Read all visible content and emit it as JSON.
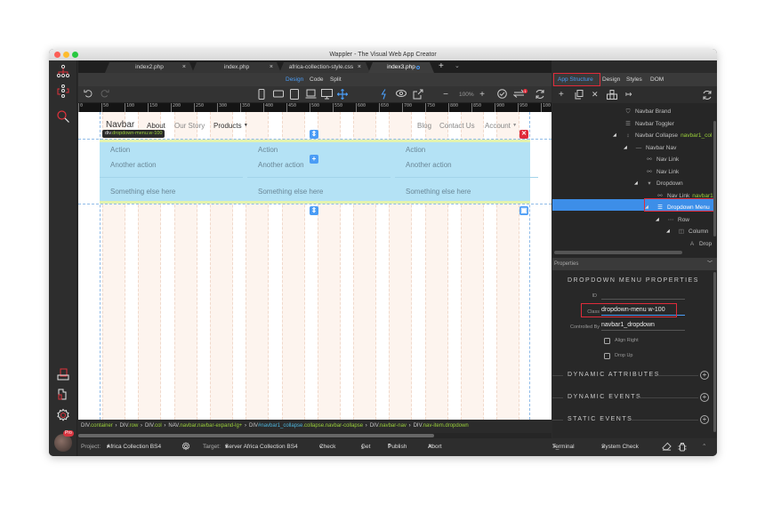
{
  "window": {
    "title": "Wappler - The Visual Web App Creator"
  },
  "tabs": [
    {
      "label": "index2.php",
      "closable": true,
      "active": false
    },
    {
      "label": "index.php",
      "closable": true,
      "active": false
    },
    {
      "label": "africa-collection-style.css",
      "closable": true,
      "active": false
    },
    {
      "label": "index3.php",
      "closable": false,
      "active": true,
      "modified": true
    }
  ],
  "tab_add": "+",
  "tab_more": "⌄",
  "modes": {
    "design": "Design",
    "code": "Code",
    "split": "Split",
    "active": "Design"
  },
  "toolbar": {
    "zoom_level": "100%",
    "zoom_out": "−",
    "zoom_in": "+",
    "notification_count": "1"
  },
  "ruler": {
    "ticks": [
      "0",
      "50",
      "100",
      "150",
      "200",
      "250",
      "300",
      "350",
      "400",
      "450",
      "500",
      "550",
      "600",
      "650",
      "700",
      "750",
      "800",
      "850",
      "900",
      "950",
      "100"
    ]
  },
  "page": {
    "navbar": {
      "brand": "Navbar",
      "links_left": [
        "About",
        "Our Story",
        "Products"
      ],
      "links_right": [
        "Blog",
        "Contact Us",
        "Account"
      ]
    },
    "element_tooltip": {
      "tag": "div",
      "classes": ".dropdown-menu.w-100"
    },
    "dropdown_columns": [
      {
        "items": [
          "Action",
          "Another action",
          "Something else here"
        ]
      },
      {
        "items": [
          "Action",
          "Another action",
          "Something else here"
        ]
      },
      {
        "items": [
          "Action",
          "Another action",
          "Something else here"
        ]
      }
    ]
  },
  "breadcrumb": [
    {
      "tag": "DIV",
      "cls": ".container",
      "id": ""
    },
    {
      "tag": "DIV",
      "cls": ".row",
      "id": ""
    },
    {
      "tag": "DIV",
      "cls": ".col",
      "id": ""
    },
    {
      "tag": "NAV",
      "cls": ".navbar.navbar-expand-lg+",
      "id": ""
    },
    {
      "tag": "DIV",
      "cls": ".collapse.navbar-collapse",
      "id": "#navbar1_collapse"
    },
    {
      "tag": "DIV",
      "cls": ".navbar-nav",
      "id": ""
    },
    {
      "tag": "DIV",
      "cls": ".nav-item.dropdown",
      "id": ""
    }
  ],
  "statusbar": {
    "project_label": "Project:",
    "project_value": "Africa Collection BS4",
    "target_label": "Target:",
    "target_value": "Server Africa Collection BS4",
    "check": "Check",
    "get": "Get",
    "publish": "Publish",
    "abort": "Abort",
    "terminal": "Terminal",
    "system_check": "System Check"
  },
  "user": {
    "badge": "Pro"
  },
  "right_panel": {
    "tabs": [
      "App Structure",
      "Design",
      "Styles",
      "DOM"
    ],
    "active_tab": "App Structure",
    "tree": [
      {
        "label": "Navbar Brand",
        "icon": "shield-icon",
        "extra": ""
      },
      {
        "label": "Navbar Toggler",
        "icon": "menu-icon",
        "extra": ""
      },
      {
        "label": "Navbar Collapse",
        "icon": "collapse-icon",
        "extra": "navbar1_col"
      },
      {
        "label": "Navbar Nav",
        "icon": "dash-icon",
        "extra": ""
      },
      {
        "label": "Nav Link",
        "icon": "link-icon",
        "extra": ""
      },
      {
        "label": "Nav Link",
        "icon": "link-icon",
        "extra": ""
      },
      {
        "label": "Dropdown",
        "icon": "dropdown-icon",
        "extra": ""
      },
      {
        "label": "Nav Link",
        "icon": "link-icon",
        "extra": "navbar1"
      },
      {
        "label": "Dropdown Menu",
        "icon": "menu-icon",
        "extra": "",
        "selected": true
      },
      {
        "label": "Row",
        "icon": "dots-icon",
        "extra": ""
      },
      {
        "label": "Column",
        "icon": "column-icon",
        "extra": ""
      },
      {
        "label": "Drop",
        "icon": "text-icon",
        "extra": ""
      }
    ],
    "properties": {
      "header": "Properties",
      "section_title": "DROPDOWN MENU PROPERTIES",
      "id_label": "ID",
      "id_value": "",
      "class_label": "Class",
      "class_value": "dropdown-menu w-100",
      "controlled_by_label": "Controlled By",
      "controlled_by_value": "navbar1_dropdown",
      "align_right": {
        "label": "Align Right",
        "checked": false
      },
      "drop_up": {
        "label": "Drop Up",
        "checked": false
      },
      "sections": [
        "DYNAMIC ATTRIBUTES",
        "DYNAMIC EVENTS",
        "STATIC EVENTS"
      ]
    }
  },
  "colors": {
    "accent": "#4a9cf5",
    "highlight_red": "#e02b3a",
    "class_green": "#9ad03a",
    "dropdown_fill": "#b4e2f5"
  }
}
